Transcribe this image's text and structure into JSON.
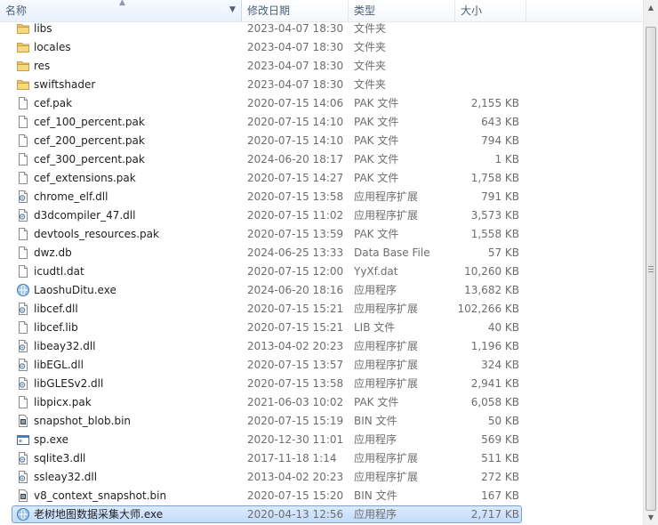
{
  "columns": {
    "name": "名称",
    "date": "修改日期",
    "type": "类型",
    "size": "大小"
  },
  "files": [
    {
      "name": "libs",
      "date": "2023-04-07 18:30",
      "type": "文件夹",
      "size": "",
      "icon": "folder-icon"
    },
    {
      "name": "locales",
      "date": "2023-04-07 18:30",
      "type": "文件夹",
      "size": "",
      "icon": "folder-icon"
    },
    {
      "name": "res",
      "date": "2023-04-07 18:30",
      "type": "文件夹",
      "size": "",
      "icon": "folder-icon"
    },
    {
      "name": "swiftshader",
      "date": "2023-04-07 18:30",
      "type": "文件夹",
      "size": "",
      "icon": "folder-icon"
    },
    {
      "name": "cef.pak",
      "date": "2020-07-15 14:06",
      "type": "PAK 文件",
      "size": "2,155 KB",
      "icon": "file-icon"
    },
    {
      "name": "cef_100_percent.pak",
      "date": "2020-07-15 14:10",
      "type": "PAK 文件",
      "size": "643 KB",
      "icon": "file-icon"
    },
    {
      "name": "cef_200_percent.pak",
      "date": "2020-07-15 14:10",
      "type": "PAK 文件",
      "size": "794 KB",
      "icon": "file-icon"
    },
    {
      "name": "cef_300_percent.pak",
      "date": "2024-06-20 18:17",
      "type": "PAK 文件",
      "size": "1 KB",
      "icon": "file-icon"
    },
    {
      "name": "cef_extensions.pak",
      "date": "2020-07-15 14:27",
      "type": "PAK 文件",
      "size": "1,758 KB",
      "icon": "file-icon"
    },
    {
      "name": "chrome_elf.dll",
      "date": "2020-07-15 13:58",
      "type": "应用程序扩展",
      "size": "791 KB",
      "icon": "dll-icon"
    },
    {
      "name": "d3dcompiler_47.dll",
      "date": "2020-07-15 11:02",
      "type": "应用程序扩展",
      "size": "3,573 KB",
      "icon": "dll-icon"
    },
    {
      "name": "devtools_resources.pak",
      "date": "2020-07-15 13:59",
      "type": "PAK 文件",
      "size": "1,558 KB",
      "icon": "file-icon"
    },
    {
      "name": "dwz.db",
      "date": "2024-06-25 13:33",
      "type": "Data Base File",
      "size": "57 KB",
      "icon": "file-icon"
    },
    {
      "name": "icudtl.dat",
      "date": "2020-07-15 12:00",
      "type": "YyXf.dat",
      "size": "10,260 KB",
      "icon": "file-icon"
    },
    {
      "name": "LaoshuDitu.exe",
      "date": "2024-06-20 18:16",
      "type": "应用程序",
      "size": "13,682 KB",
      "icon": "globe-app-icon"
    },
    {
      "name": "libcef.dll",
      "date": "2020-07-15 15:21",
      "type": "应用程序扩展",
      "size": "102,266 KB",
      "icon": "dll-icon"
    },
    {
      "name": "libcef.lib",
      "date": "2020-07-15 15:21",
      "type": "LIB 文件",
      "size": "40 KB",
      "icon": "file-icon"
    },
    {
      "name": "libeay32.dll",
      "date": "2013-04-02 20:23",
      "type": "应用程序扩展",
      "size": "1,196 KB",
      "icon": "dll-icon"
    },
    {
      "name": "libEGL.dll",
      "date": "2020-07-15 13:57",
      "type": "应用程序扩展",
      "size": "324 KB",
      "icon": "dll-icon"
    },
    {
      "name": "libGLESv2.dll",
      "date": "2020-07-15 13:58",
      "type": "应用程序扩展",
      "size": "2,941 KB",
      "icon": "dll-icon"
    },
    {
      "name": "libpicx.pak",
      "date": "2021-06-03 10:02",
      "type": "PAK 文件",
      "size": "6,058 KB",
      "icon": "file-icon"
    },
    {
      "name": "snapshot_blob.bin",
      "date": "2020-07-15 15:19",
      "type": "BIN 文件",
      "size": "50 KB",
      "icon": "bin-icon"
    },
    {
      "name": "sp.exe",
      "date": "2020-12-30 11:01",
      "type": "应用程序",
      "size": "569 KB",
      "icon": "exe-window-icon"
    },
    {
      "name": "sqlite3.dll",
      "date": "2017-11-18 1:14",
      "type": "应用程序扩展",
      "size": "511 KB",
      "icon": "dll-icon"
    },
    {
      "name": "ssleay32.dll",
      "date": "2013-04-02 20:23",
      "type": "应用程序扩展",
      "size": "272 KB",
      "icon": "dll-icon"
    },
    {
      "name": "v8_context_snapshot.bin",
      "date": "2020-07-15 15:20",
      "type": "BIN 文件",
      "size": "167 KB",
      "icon": "bin-icon"
    },
    {
      "name": "老树地图数据采集大师.exe",
      "date": "2020-04-13 12:56",
      "type": "应用程序",
      "size": "2,717 KB",
      "icon": "globe-app-icon",
      "selected": true
    }
  ],
  "colors": {
    "folder": "#e9c46a",
    "selection": "#c9e0fb",
    "header_text": "#4c607a"
  }
}
